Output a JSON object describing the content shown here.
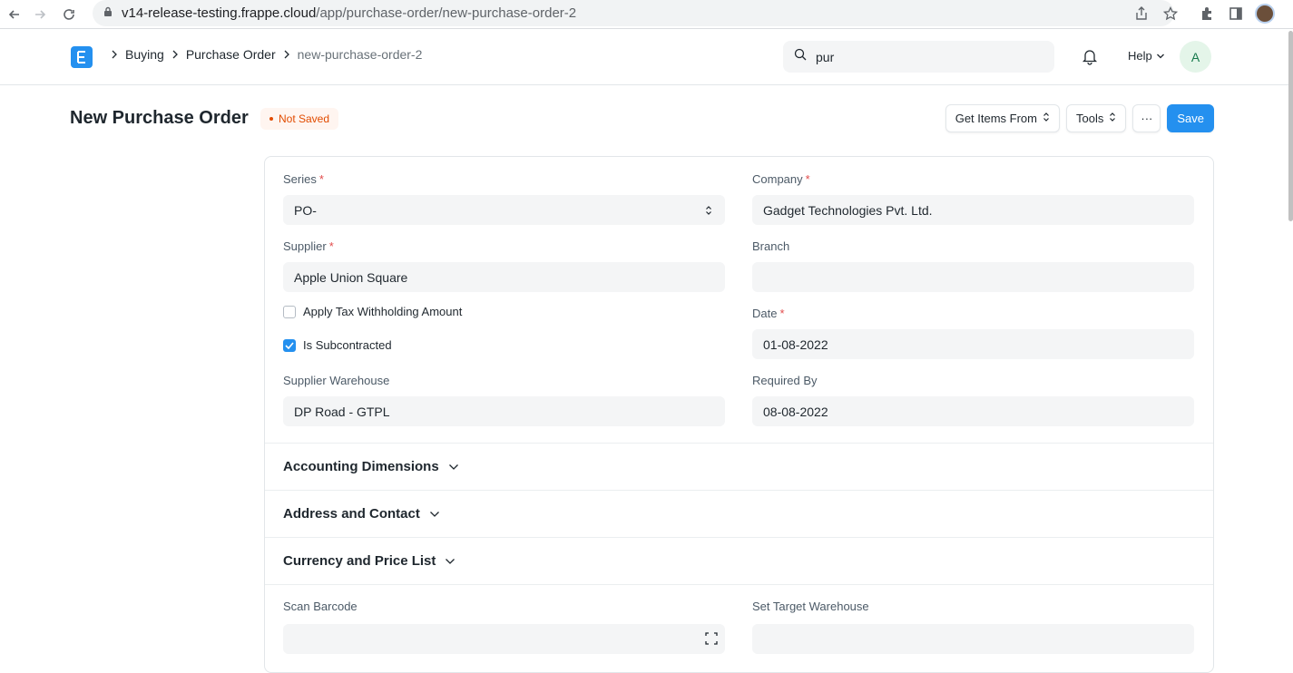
{
  "browser": {
    "url_host": "v14-release-testing.frappe.cloud",
    "url_path": "/app/purchase-order/new-purchase-order-2"
  },
  "navbar": {
    "breadcrumbs": [
      "Buying",
      "Purchase Order",
      "new-purchase-order-2"
    ],
    "search_value": "pur",
    "help_label": "Help",
    "avatar_initial": "A"
  },
  "page": {
    "title": "New Purchase Order",
    "status": "Not Saved",
    "actions": {
      "get_items": "Get Items From",
      "tools": "Tools",
      "more": "···",
      "save": "Save"
    }
  },
  "form": {
    "series": {
      "label": "Series",
      "value": "PO-"
    },
    "company": {
      "label": "Company",
      "value": "Gadget Technologies Pvt. Ltd."
    },
    "supplier": {
      "label": "Supplier",
      "value": "Apple Union Square"
    },
    "branch": {
      "label": "Branch",
      "value": ""
    },
    "apply_tax": {
      "label": "Apply Tax Withholding Amount",
      "checked": false
    },
    "is_subcontracted": {
      "label": "Is Subcontracted",
      "checked": true
    },
    "date": {
      "label": "Date",
      "value": "01-08-2022"
    },
    "supplier_warehouse": {
      "label": "Supplier Warehouse",
      "value": "DP Road - GTPL"
    },
    "required_by": {
      "label": "Required By",
      "value": "08-08-2022"
    },
    "scan_barcode": {
      "label": "Scan Barcode",
      "value": ""
    },
    "set_target_warehouse": {
      "label": "Set Target Warehouse",
      "value": ""
    }
  },
  "sections": [
    "Accounting Dimensions",
    "Address and Contact",
    "Currency and Price List"
  ],
  "colors": {
    "primary": "#2490ef",
    "status": "#e24c00"
  }
}
